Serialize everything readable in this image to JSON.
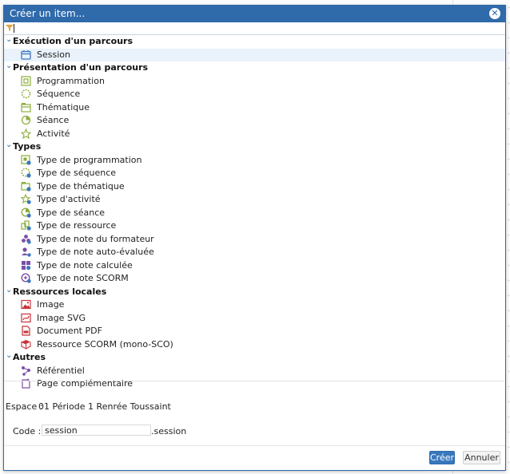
{
  "dialog": {
    "title": "Créer un item..."
  },
  "filter": {
    "value": ""
  },
  "groups": [
    {
      "label": "Exécution d'un parcours",
      "items": [
        {
          "label": "Session",
          "icon": "calendar-icon",
          "color": "#3a78bd",
          "selected": true
        }
      ]
    },
    {
      "label": "Présentation d'un parcours",
      "items": [
        {
          "label": "Programmation",
          "icon": "programmation-icon",
          "color": "#8dae3c"
        },
        {
          "label": "Séquence",
          "icon": "sequence-icon",
          "color": "#8dae3c"
        },
        {
          "label": "Thématique",
          "icon": "thematique-icon",
          "color": "#8dae3c"
        },
        {
          "label": "Séance",
          "icon": "seance-icon",
          "color": "#8dae3c"
        },
        {
          "label": "Activité",
          "icon": "activite-icon",
          "color": "#8dae3c"
        }
      ]
    },
    {
      "label": "Types",
      "items": [
        {
          "label": "Type de programmation",
          "icon": "type-programmation-icon",
          "color": "#8dae3c"
        },
        {
          "label": "Type de séquence",
          "icon": "type-sequence-icon",
          "color": "#8dae3c"
        },
        {
          "label": "Type de thématique",
          "icon": "type-thematique-icon",
          "color": "#8dae3c"
        },
        {
          "label": "Type d'activité",
          "icon": "type-activite-icon",
          "color": "#8dae3c"
        },
        {
          "label": "Type de séance",
          "icon": "type-seance-icon",
          "color": "#8dae3c"
        },
        {
          "label": "Type de ressource",
          "icon": "type-ressource-icon",
          "color": "#8dae3c"
        },
        {
          "label": "Type de note du formateur",
          "icon": "type-note-formateur-icon",
          "color": "#7b4fa8"
        },
        {
          "label": "Type de note auto-évaluée",
          "icon": "type-note-auto-icon",
          "color": "#7b4fa8"
        },
        {
          "label": "Type de note calculée",
          "icon": "type-note-calculee-icon",
          "color": "#7b4fa8"
        },
        {
          "label": "Type de note SCORM",
          "icon": "type-note-scorm-icon",
          "color": "#7b4fa8"
        }
      ]
    },
    {
      "label": "Ressources locales",
      "items": [
        {
          "label": "Image",
          "icon": "image-icon",
          "color": "#c8323a"
        },
        {
          "label": "Image SVG",
          "icon": "image-svg-icon",
          "color": "#c8323a"
        },
        {
          "label": "Document PDF",
          "icon": "pdf-icon",
          "color": "#c8323a"
        },
        {
          "label": "Ressource SCORM (mono-SCO)",
          "icon": "scorm-icon",
          "color": "#c8323a"
        }
      ]
    },
    {
      "label": "Autres",
      "items": [
        {
          "label": "Référentiel",
          "icon": "referentiel-icon",
          "color": "#7b4fa8"
        },
        {
          "label": "Page complémentaire",
          "icon": "page-icon",
          "color": "#7b4fa8"
        }
      ]
    }
  ],
  "espace": {
    "label": "Espace :",
    "value": "01 Période 1 Renrée Toussaint"
  },
  "code": {
    "label": "Code :",
    "value": "session",
    "suffix": ".session"
  },
  "buttons": {
    "create": "Créer",
    "cancel": "Annuler"
  }
}
